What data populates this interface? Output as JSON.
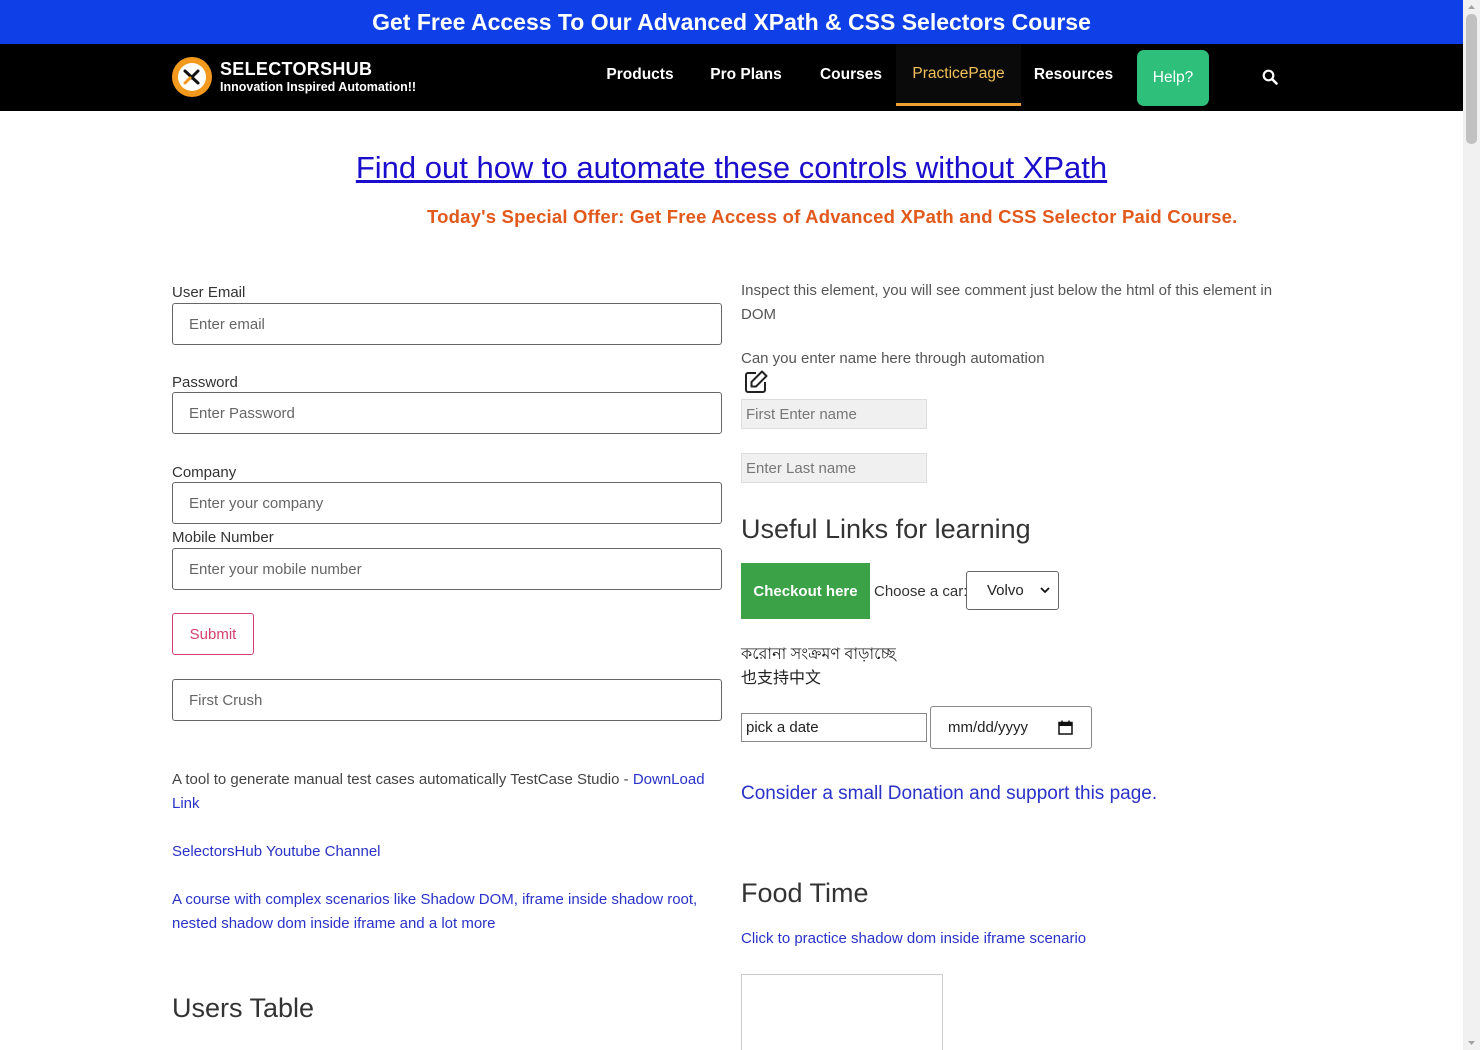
{
  "banner": {
    "text": "Get Free Access To Our Advanced XPath & CSS Selectors Course"
  },
  "brand": {
    "title": "SELECTORSHUB",
    "tagline": "Innovation Inspired Automation!!"
  },
  "nav": {
    "items": [
      {
        "label": "Products"
      },
      {
        "label": "Pro Plans"
      },
      {
        "label": "Courses"
      },
      {
        "label": "PracticePage",
        "active": true
      },
      {
        "label": "Resources"
      }
    ],
    "help_label": "Help?",
    "search_icon": "search-icon"
  },
  "headline": {
    "link_text": "Find out how to automate these controls without XPath"
  },
  "offer": {
    "text": "Today's Special Offer: Get Free Access of Advanced XPath and CSS Selector Paid Course."
  },
  "form": {
    "email_label": "User Email",
    "email_placeholder": "Enter email",
    "password_label": "Password",
    "password_placeholder": "Enter Password",
    "company_label": "Company",
    "company_placeholder": "Enter your company",
    "mobile_label": "Mobile Number",
    "mobile_placeholder": "Enter your mobile number",
    "submit_label": "Submit",
    "crush_placeholder": "First Crush"
  },
  "left_links": {
    "testcase_text": "A tool to generate manual test cases automatically TestCase Studio - ",
    "testcase_link": "DownLoad Link",
    "youtube_link": "SelectorsHub Youtube Channel",
    "course_link": "A course with complex scenarios like Shadow DOM, iframe inside shadow root, nested shadow dom inside iframe and a lot more"
  },
  "users_table": {
    "heading": "Users Table"
  },
  "right": {
    "inspect_text": "Inspect this element, you will see comment just below the html of this element in DOM",
    "enter_name_text": "Can you enter name here through automation",
    "edit_icon": "edit-icon",
    "first_name_placeholder": "First Enter name",
    "last_name_placeholder": "Enter Last name",
    "useful_links_heading": "Useful Links for learning",
    "checkout_label": "Checkout here",
    "car_label": "Choose a car:",
    "car_selected": "Volvo",
    "bengali_text": "করোনা সংক্রমণ বাড়াচ্ছে",
    "chinese_text": "也支持中文",
    "pick_date_value": "pick a date",
    "date_placeholder": "mm/dd/yyyy",
    "donation_link": "Consider a small Donation and support this page.",
    "food_heading": "Food Time",
    "shadow_iframe_link": "Click to practice shadow dom inside iframe scenario"
  },
  "colors": {
    "banner_bg": "#0f3fe6",
    "nav_bg": "#000000",
    "active_nav": "#f3c15a",
    "help_bg": "#2ebf7a",
    "offer": "#e2591c",
    "link": "#2a32c8",
    "checkout_bg": "#3ca247",
    "submit": "#d5406e"
  }
}
